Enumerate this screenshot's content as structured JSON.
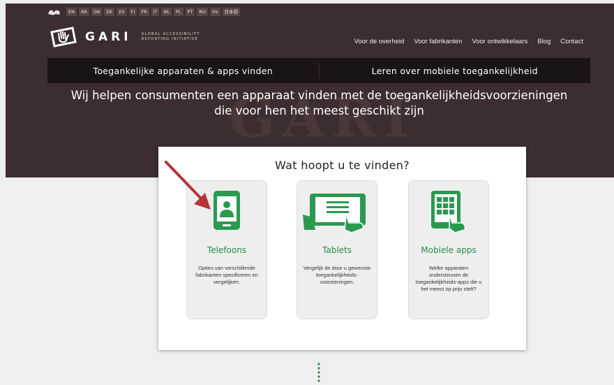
{
  "languages": [
    "EN",
    "AR",
    "DA",
    "DE",
    "ES",
    "FI",
    "FR",
    "IT",
    "NL",
    "PL",
    "PT",
    "RO",
    "SV",
    "日本語"
  ],
  "brand": {
    "name": "GARI",
    "subtitle_line1": "GLOBAL ACCESSIBILITY",
    "subtitle_line2": "REPORTING INITIATIVE"
  },
  "topnav": [
    "Voor de overheid",
    "Voor fabrikanten",
    "Voor ontwikkelaars",
    "Blog",
    "Contact"
  ],
  "mainnav": {
    "left": "Toegankelijke apparaten & apps vinden",
    "right": "Leren over mobiele toegankelijkheid"
  },
  "hero": {
    "title_line1": "Wij helpen consumenten een apparaat vinden met de toegankelijkheidsvoorzieningen",
    "title_line2": "die voor hen het meest geschikt zijn",
    "watermark": "GARI"
  },
  "panel": {
    "title": "Wat hoopt u te vinden?",
    "cards": [
      {
        "title": "Telefoons",
        "desc": "Opties van verschillende fabrikanten specificeren en vergelijken.",
        "icon": "phone-icon"
      },
      {
        "title": "Tablets",
        "desc": "Vergelijk de door u gewenste toegankelijkheids-voorzieningen.",
        "icon": "tablet-icon"
      },
      {
        "title": "Mobiele apps",
        "desc": "Welke apparaten ondersteunen de toegankelijkheids-apps die u het meest op prijs stelt?",
        "icon": "apps-icon"
      }
    ]
  },
  "colors": {
    "hero_bg": "#3c2e30",
    "nav_bg": "#1a1414",
    "accent_green": "#2a8a4a",
    "arrow_red": "#b5343a"
  }
}
